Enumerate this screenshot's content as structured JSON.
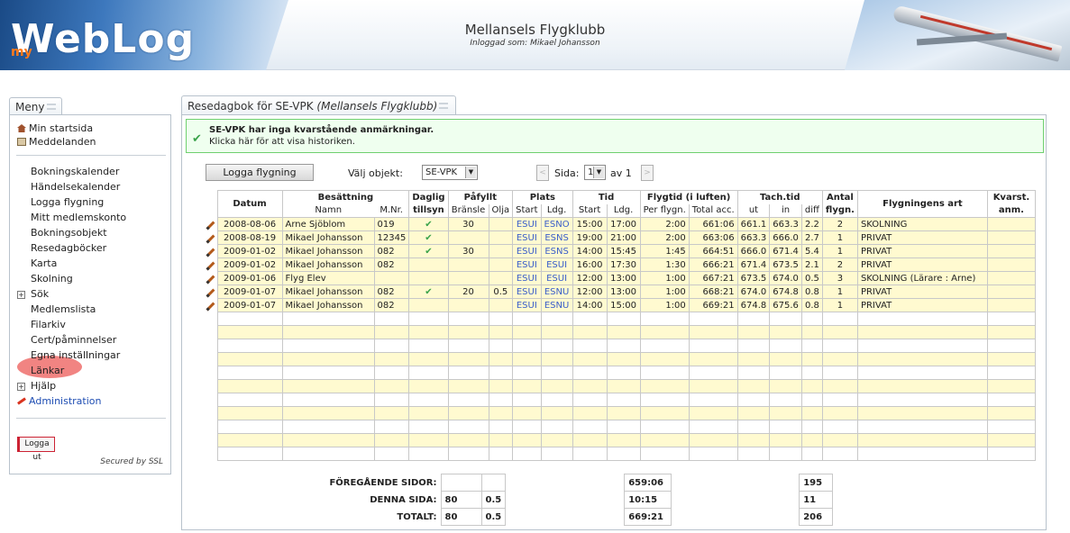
{
  "header": {
    "logo_prefix": "my",
    "logo": "WebLog",
    "title": "Mellansels Flygklubb",
    "subtitle": "Inloggad som: Mikael Johansson"
  },
  "menu": {
    "tab": "Meny",
    "top_items": [
      "Min startsida",
      "Meddelanden"
    ],
    "items": [
      "Bokningskalender",
      "Händelsekalender",
      "Logga flygning",
      "Mitt medlemskonto",
      "Bokningsobjekt",
      "Resedagböcker",
      "Karta",
      "Skolning",
      "Sök",
      "Medlemslista",
      "Filarkiv",
      "Cert/påminnelser",
      "Egna inställningar",
      "Länkar",
      "Hjälp",
      "Administration"
    ],
    "logout": "Logga ut",
    "ssl": "Secured by SSL"
  },
  "main": {
    "tab_title": "Resedagbok för SE-VPK",
    "tab_title_italic": "(Mellansels Flygklubb)",
    "notice_line1": "SE-VPK har inga kvarstående anmärkningar.",
    "notice_line2": "Klicka här för att visa historiken.",
    "log_button": "Logga flygning",
    "object_label": "Välj objekt:",
    "object_value": "SE-VPK",
    "page_label": "Sida:",
    "page_value": "1",
    "page_of": "av 1"
  },
  "table": {
    "headers": {
      "datum": "Datum",
      "besattning": "Besättning",
      "namn": "Namn",
      "mnr": "M.Nr.",
      "daglig": "Daglig",
      "tillsyn": "tillsyn",
      "pafyllt": "Påfyllt",
      "bransle": "Bränsle",
      "olja": "Olja",
      "plats": "Plats",
      "start": "Start",
      "ldg": "Ldg.",
      "tid": "Tid",
      "flygtid": "Flygtid (i luften)",
      "per_flygn": "Per flygn.",
      "total_acc": "Total acc.",
      "tach": "Tach.tid",
      "ut": "ut",
      "in": "in",
      "diff": "diff",
      "antal": "Antal",
      "flygn": "flygn.",
      "art": "Flygningens art",
      "kvarst": "Kvarst.",
      "anm": "anm."
    },
    "rows": [
      {
        "datum": "2008-08-06",
        "namn": "Arne Sjöblom",
        "mnr": "019",
        "tillsyn": "✔",
        "bransle": "30",
        "olja": "",
        "start_plats": "ESUI",
        "ldg_plats": "ESNO",
        "start_tid": "15:00",
        "ldg_tid": "17:00",
        "per": "2:00",
        "total": "661:06",
        "ut": "661.1",
        "in": "663.3",
        "diff": "2.2",
        "antal": "2",
        "art": "SKOLNING",
        "kvarst": ""
      },
      {
        "datum": "2008-08-19",
        "namn": "Mikael Johansson",
        "mnr": "12345",
        "tillsyn": "✔",
        "bransle": "",
        "olja": "",
        "start_plats": "ESUI",
        "ldg_plats": "ESNS",
        "start_tid": "19:00",
        "ldg_tid": "21:00",
        "per": "2:00",
        "total": "663:06",
        "ut": "663.3",
        "in": "666.0",
        "diff": "2.7",
        "antal": "1",
        "art": "PRIVAT",
        "kvarst": ""
      },
      {
        "datum": "2009-01-02",
        "namn": "Mikael Johansson",
        "mnr": "082",
        "tillsyn": "✔",
        "bransle": "30",
        "olja": "",
        "start_plats": "ESUI",
        "ldg_plats": "ESNS",
        "start_tid": "14:00",
        "ldg_tid": "15:45",
        "per": "1:45",
        "total": "664:51",
        "ut": "666.0",
        "in": "671.4",
        "diff": "5.4",
        "antal": "1",
        "art": "PRIVAT",
        "kvarst": ""
      },
      {
        "datum": "2009-01-02",
        "namn": "Mikael Johansson",
        "mnr": "082",
        "tillsyn": "",
        "bransle": "",
        "olja": "",
        "start_plats": "ESUI",
        "ldg_plats": "ESUI",
        "start_tid": "16:00",
        "ldg_tid": "17:30",
        "per": "1:30",
        "total": "666:21",
        "ut": "671.4",
        "in": "673.5",
        "diff": "2.1",
        "antal": "2",
        "art": "PRIVAT",
        "kvarst": ""
      },
      {
        "datum": "2009-01-06",
        "namn": "Flyg Elev",
        "mnr": "",
        "tillsyn": "",
        "bransle": "",
        "olja": "",
        "start_plats": "ESUI",
        "ldg_plats": "ESUI",
        "start_tid": "12:00",
        "ldg_tid": "13:00",
        "per": "1:00",
        "total": "667:21",
        "ut": "673.5",
        "in": "674.0",
        "diff": "0.5",
        "antal": "3",
        "art": "SKOLNING (Lärare : Arne)",
        "kvarst": ""
      },
      {
        "datum": "2009-01-07",
        "namn": "Mikael Johansson",
        "mnr": "082",
        "tillsyn": "✔",
        "bransle": "20",
        "olja": "0.5",
        "start_plats": "ESUI",
        "ldg_plats": "ESNU",
        "start_tid": "12:00",
        "ldg_tid": "13:00",
        "per": "1:00",
        "total": "668:21",
        "ut": "674.0",
        "in": "674.8",
        "diff": "0.8",
        "antal": "1",
        "art": "PRIVAT",
        "kvarst": ""
      },
      {
        "datum": "2009-01-07",
        "namn": "Mikael Johansson",
        "mnr": "082",
        "tillsyn": "",
        "bransle": "",
        "olja": "",
        "start_plats": "ESUI",
        "ldg_plats": "ESNU",
        "start_tid": "14:00",
        "ldg_tid": "15:00",
        "per": "1:00",
        "total": "669:21",
        "ut": "674.8",
        "in": "675.6",
        "diff": "0.8",
        "antal": "1",
        "art": "PRIVAT",
        "kvarst": ""
      }
    ],
    "empty_rows": 11
  },
  "summary": {
    "prev_label": "FÖREGÅENDE SIDOR:",
    "prev_bransle": "",
    "prev_olja": "",
    "prev_flygtid": "659:06",
    "prev_antal": "195",
    "page_label": "DENNA SIDA:",
    "page_bransle": "80",
    "page_olja": "0.5",
    "page_flygtid": "10:15",
    "page_antal": "11",
    "total_label": "TOTALT:",
    "total_bransle": "80",
    "total_olja": "0.5",
    "total_flygtid": "669:21",
    "total_antal": "206"
  },
  "colors": {
    "row_yellow": "#fffad0",
    "notice_green": "#efffef",
    "link_blue": "#3a5ec9",
    "check_green": "#3aa34a"
  },
  "icons": [
    "home-icon",
    "mail-icon",
    "edit-pencil-icon",
    "check-icon",
    "admin-hammer-icon"
  ]
}
